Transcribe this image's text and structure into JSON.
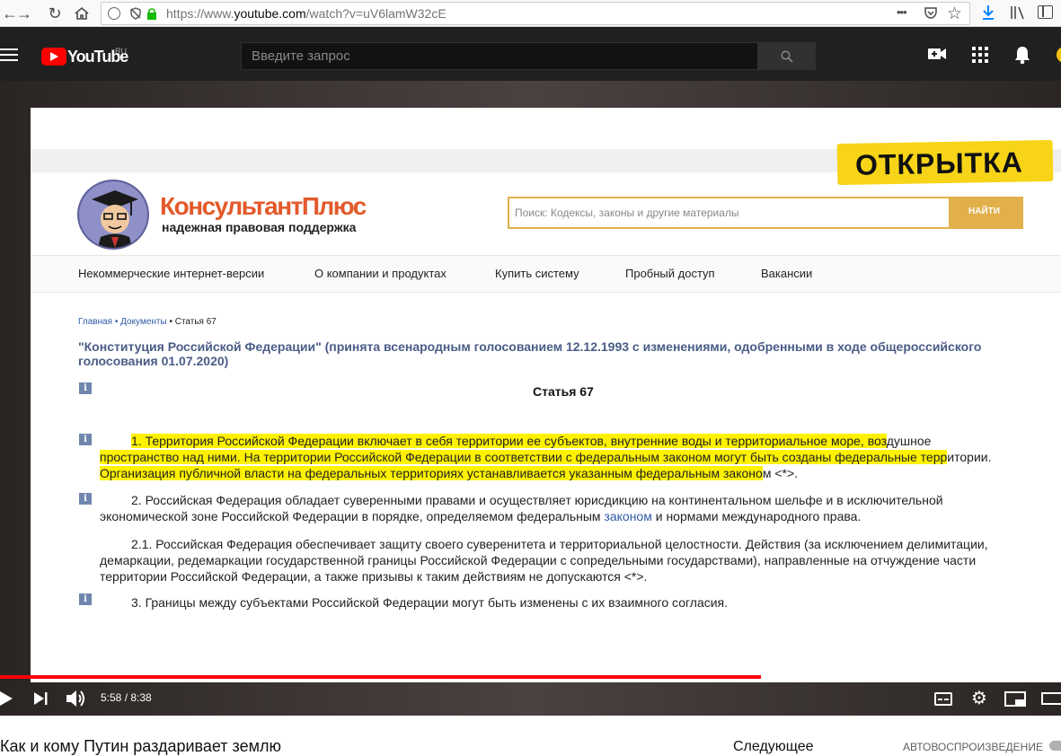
{
  "browser": {
    "url_prefix": "https://www.",
    "url_domain": "youtube.com",
    "url_path": "/watch?v=uV6lamW32cE",
    "more_icon": "•••"
  },
  "youtube": {
    "logo_text": "YouTube",
    "region": "RU",
    "search_placeholder": "Введите запрос"
  },
  "document": {
    "stamp": "ОТКРЫТКА",
    "brand_name": "КонсультантПлюс",
    "brand_tagline": "надежная правовая поддержка",
    "search_placeholder": "Поиск: Кодексы, законы и другие материалы",
    "search_button": "НАЙТИ",
    "nav": [
      "Некоммерческие интернет-версии",
      "О компании и продуктах",
      "Купить систему",
      "Пробный доступ",
      "Вакансии"
    ],
    "breadcrumb": [
      "Главная",
      "• Документы",
      "• Статья 67"
    ],
    "doc_title_line1": "\"Конституция Российской Федерации\" (принята всенародным голосованием 12.12.1993 с изменениями, одобренными в ходе общероссийского",
    "doc_title_line2": "голосования 01.07.2020)",
    "article_heading": "Статья 67",
    "info_icon": "i",
    "p1_l1_hl": "1. Территория Российской Федерации включает в себя территории ее субъектов, внутренние воды и территориальное море, воз",
    "p1_l1_rest": "душное",
    "p1_l2_hl": "пространство над ними. На территории Российской Федерации в соответствии с федеральным законом могут быть созданы федеральные терр",
    "p1_l2_rest": "итории.",
    "p1_l3_hl": "Организация публичной власти на федеральных территориях устанавливается указанным федеральным законо",
    "p1_l3_rest": "м <*>.",
    "p2_l1": "2. Российская Федерация обладает суверенными правами и осуществляет юрисдикцию на континентальном шельфе и в исключительной",
    "p2_l2_a": "экономической зоне Российской Федерации в порядке, определяемом федеральным ",
    "p2_l2_link": "законом",
    "p2_l2_b": " и нормами международного права.",
    "p3_l1": "2.1. Российская Федерация обеспечивает защиту своего суверенитета и территориальной целостности. Действия (за исключением делимитации,",
    "p3_l2": "демаркации, редемаркации государственной границы Российской Федерации с сопредельными государствами), направленные на отчуждение части",
    "p3_l3": "территории Российской Федерации, а также призывы к таким действиям не допускаются <*>.",
    "p4_l1": "3. Границы между субъектами Российской Федерации могут быть изменены с их взаимного согласия."
  },
  "player": {
    "time": "5:58 / 8:38",
    "played_fraction": 0.717,
    "buffered_fraction": 0.896
  },
  "below": {
    "video_title": "Как и кому Путин раздаривает землю",
    "next_label": "Следующее",
    "autoplay_label": "АВТОВОСПРОИЗВЕДЕНИЕ"
  },
  "colors": {
    "yt_red": "#ff0000",
    "consultant_orange": "#e35a2b",
    "search_button_gold": "#e1b04a",
    "highlight_yellow": "#fff200"
  }
}
